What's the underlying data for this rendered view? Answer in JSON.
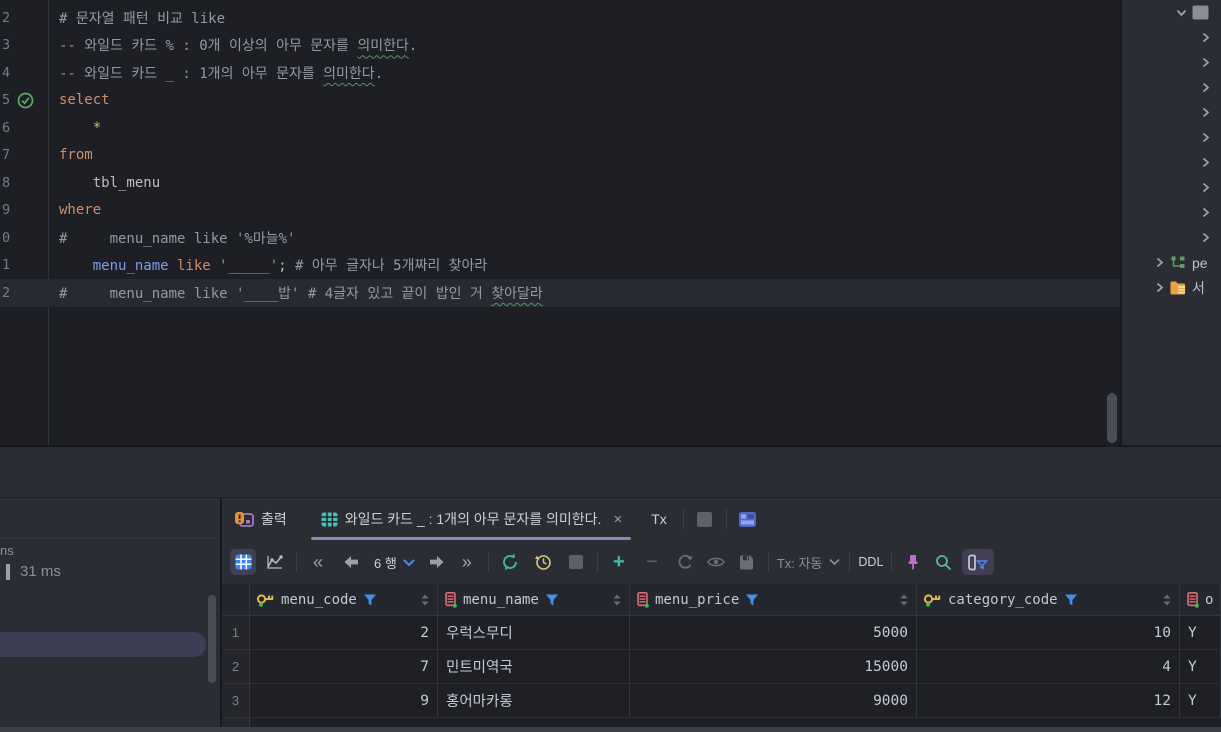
{
  "editor": {
    "lines": [
      {
        "num": "2",
        "tokens": [
          {
            "t": "comment",
            "text": "# 문자열 패턴 비교 like"
          }
        ]
      },
      {
        "num": "3",
        "tokens": [
          {
            "t": "comment",
            "text": "-- 와일드 카드 % : 0개 이상의 아무 문자를 "
          },
          {
            "t": "comment",
            "sq": true,
            "text": "의미한다"
          },
          {
            "t": "comment",
            "text": "."
          }
        ]
      },
      {
        "num": "4",
        "tokens": [
          {
            "t": "comment",
            "text": "-- 와일드 카드 _ : 1개의 아무 문자를 "
          },
          {
            "t": "comment",
            "sq": true,
            "text": "의미한다"
          },
          {
            "t": "comment",
            "text": "."
          }
        ]
      },
      {
        "num": "5",
        "run": true,
        "tokens": [
          {
            "t": "keyword",
            "text": "select"
          }
        ]
      },
      {
        "num": "6",
        "tokens": [
          {
            "t": "plain",
            "text": "    "
          },
          {
            "t": "star",
            "text": "*"
          }
        ]
      },
      {
        "num": "7",
        "tokens": [
          {
            "t": "keyword",
            "text": "from"
          }
        ]
      },
      {
        "num": "8",
        "tokens": [
          {
            "t": "plain",
            "text": "    tbl_menu"
          }
        ]
      },
      {
        "num": "9",
        "tokens": [
          {
            "t": "keyword",
            "text": "where"
          }
        ]
      },
      {
        "num": "0",
        "tokens": [
          {
            "t": "comment",
            "text": "#     menu_name like '%마늘%'"
          }
        ]
      },
      {
        "num": "1",
        "tokens": [
          {
            "t": "plain",
            "text": "    "
          },
          {
            "t": "column",
            "text": "menu_name"
          },
          {
            "t": "plain",
            "text": " "
          },
          {
            "t": "keyword",
            "text": "like"
          },
          {
            "t": "plain",
            "text": " "
          },
          {
            "t": "string",
            "text": "'_____'"
          },
          {
            "t": "plain",
            "text": ";"
          },
          {
            "t": "comment",
            "text": " # 아무 글자나 5개짜리 찾아라"
          }
        ]
      },
      {
        "num": "2",
        "caret": true,
        "tokens": [
          {
            "t": "comment",
            "text": "#     menu_name like '____밥' # 4글자 있고 끝이 밥인 거 "
          },
          {
            "t": "comment",
            "sq": true,
            "text": "찾아달라"
          }
        ]
      }
    ]
  },
  "explorer": {
    "items": [
      {
        "kind": "root",
        "chevron": "down",
        "icon": "gray-box",
        "label": ""
      },
      {
        "kind": "child",
        "chevron": "right"
      },
      {
        "kind": "child",
        "chevron": "right"
      },
      {
        "kind": "child",
        "chevron": "right"
      },
      {
        "kind": "child",
        "chevron": "right"
      },
      {
        "kind": "child",
        "chevron": "right"
      },
      {
        "kind": "child",
        "chevron": "right"
      },
      {
        "kind": "child",
        "chevron": "right"
      },
      {
        "kind": "child",
        "chevron": "right"
      },
      {
        "kind": "child",
        "chevron": "right"
      },
      {
        "kind": "outer",
        "chevron": "right",
        "icon": "schema",
        "label": "pe"
      },
      {
        "kind": "outer",
        "chevron": "right",
        "icon": "folder",
        "label": "서"
      }
    ]
  },
  "services": {
    "cut_text": "ns",
    "duration": "31 ms"
  },
  "tabs": {
    "output_label": "출력",
    "result_label": "와일드 카드 _ : 1개의 아무 문자를 의미한다.",
    "close_label": "×",
    "tx_label": "Tx"
  },
  "toolbar": {
    "page_size": "6 행",
    "first": "«",
    "last": "»",
    "plus": "+",
    "minus": "−",
    "tx_mode": "Tx: 자동",
    "ddl": "DDL"
  },
  "table": {
    "columns": [
      {
        "icon": "key",
        "label": "menu_code"
      },
      {
        "icon": "column",
        "label": "menu_name"
      },
      {
        "icon": "column",
        "label": "menu_price"
      },
      {
        "icon": "key",
        "label": "category_code"
      },
      {
        "icon": "column",
        "label": "o"
      }
    ],
    "rows": [
      {
        "num": "1",
        "cells": [
          "2",
          "우럭스무디",
          "5000",
          "10",
          "Y"
        ]
      },
      {
        "num": "2",
        "cells": [
          "7",
          "민트미역국",
          "15000",
          "4",
          "Y"
        ]
      },
      {
        "num": "3",
        "cells": [
          "9",
          "홍어마카롱",
          "9000",
          "12",
          "Y"
        ]
      }
    ]
  },
  "colors": {
    "accent_blue": "#3b82f6",
    "teal": "#3fbda9",
    "funnel_blue": "#4090e8",
    "tab_underline": "#9184b8",
    "keyword_orange": "#cf8e6d",
    "string_green": "#6aab73",
    "key_gold": "#e3b84c",
    "column_red": "#e06c75"
  }
}
